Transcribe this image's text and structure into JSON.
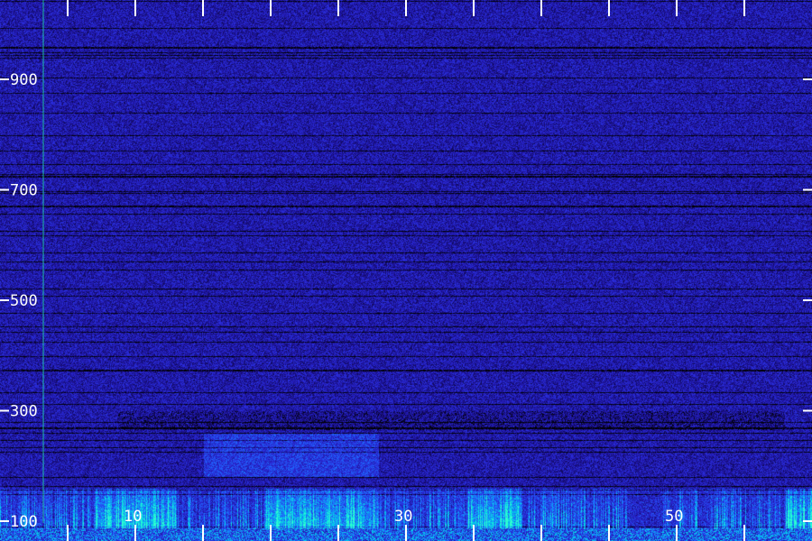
{
  "chart_data": {
    "type": "heatmap",
    "title": "",
    "xlabel": "",
    "ylabel": "",
    "y_ticks": [
      {
        "value": 900,
        "label": "900"
      },
      {
        "value": 700,
        "label": "700"
      },
      {
        "value": 500,
        "label": "500"
      },
      {
        "value": 300,
        "label": "300"
      },
      {
        "value": 100,
        "label": "100"
      }
    ],
    "x_ticks": [
      {
        "value": 10,
        "label": "10"
      },
      {
        "value": 30,
        "label": "30"
      },
      {
        "value": 50,
        "label": "50"
      }
    ],
    "xlim": [
      0,
      60
    ],
    "ylim": [
      100,
      1000
    ],
    "minor_x_tick_step": 5,
    "colormap": [
      "#000000",
      "#1a0f8c",
      "#2a2ad8",
      "#1e6bff",
      "#00d0e8",
      "#30ffd0"
    ],
    "background_color": "#13106a",
    "marker_line_color": "#1fd9a5",
    "marker_line_x": 3.2,
    "energy_bands": [
      {
        "y_from": 100,
        "y_to": 160,
        "level": 0.85,
        "note": "strong low-frequency energy with vertical streaks"
      },
      {
        "y_from": 180,
        "y_to": 260,
        "level": 0.45,
        "x_from": 15,
        "x_to": 28
      },
      {
        "y_from": 260,
        "y_to": 300,
        "level": 0.1,
        "note": "dark band"
      }
    ],
    "grid": false
  }
}
